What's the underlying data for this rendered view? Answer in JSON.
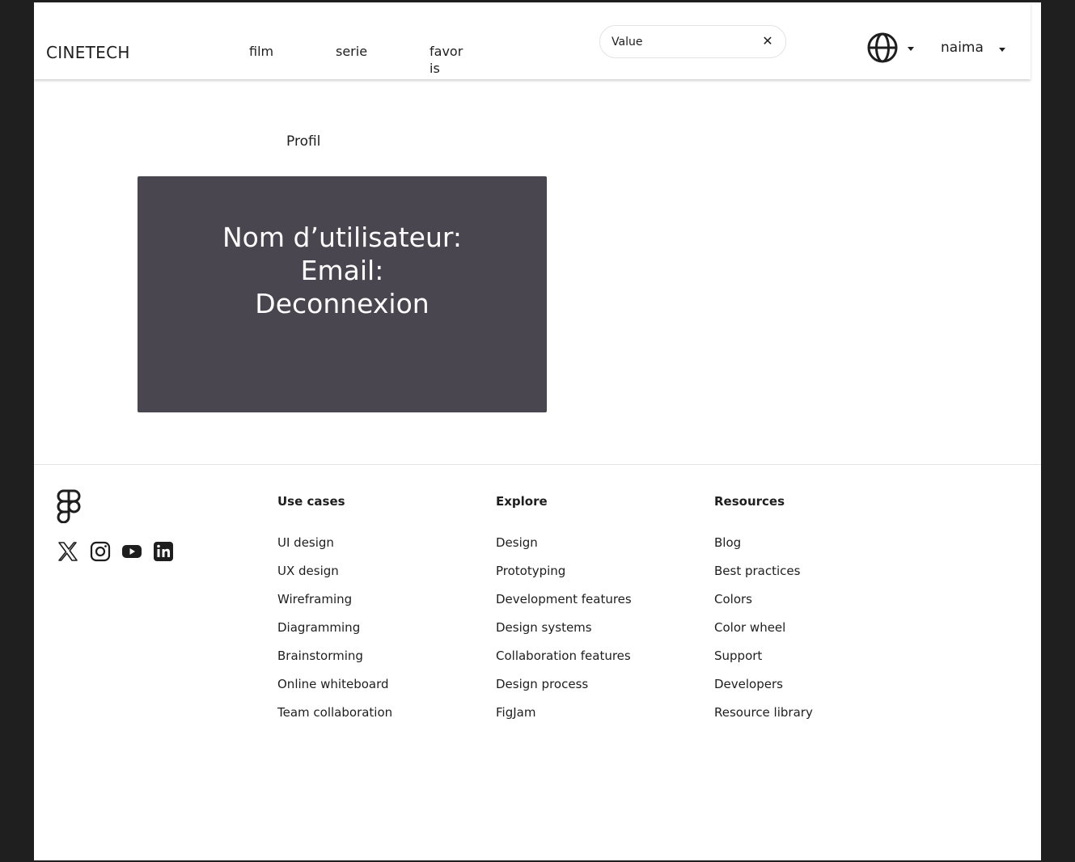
{
  "header": {
    "brand": "CINETECH",
    "nav": [
      {
        "label": "film"
      },
      {
        "label": "serie"
      },
      {
        "label": "favoris"
      }
    ],
    "search": {
      "value": "Value",
      "clear_icon": "close-icon"
    },
    "language_icon": "globe-icon",
    "user": {
      "name": "naima"
    }
  },
  "main": {
    "profile_title": "Profil",
    "card": {
      "username_label": "Nom d’utilisateur:",
      "email_label": "Email:",
      "logout_label": "Deconnexion"
    },
    "card_color": "#49464f"
  },
  "footer": {
    "logo_icon": "figma-logo-icon",
    "socials": [
      "x-icon",
      "instagram-icon",
      "youtube-icon",
      "linkedin-icon"
    ],
    "columns": [
      {
        "title": "Use cases",
        "items": [
          "UI design",
          "UX design",
          "Wireframing",
          "Diagramming",
          "Brainstorming",
          "Online whiteboard",
          "Team collaboration"
        ]
      },
      {
        "title": "Explore",
        "items": [
          "Design",
          "Prototyping",
          "Development features",
          "Design systems",
          "Collaboration features",
          "Design process",
          "FigJam"
        ]
      },
      {
        "title": "Resources",
        "items": [
          "Blog",
          "Best practices",
          "Colors",
          "Color wheel",
          "Support",
          "Developers",
          "Resource library"
        ]
      }
    ]
  }
}
